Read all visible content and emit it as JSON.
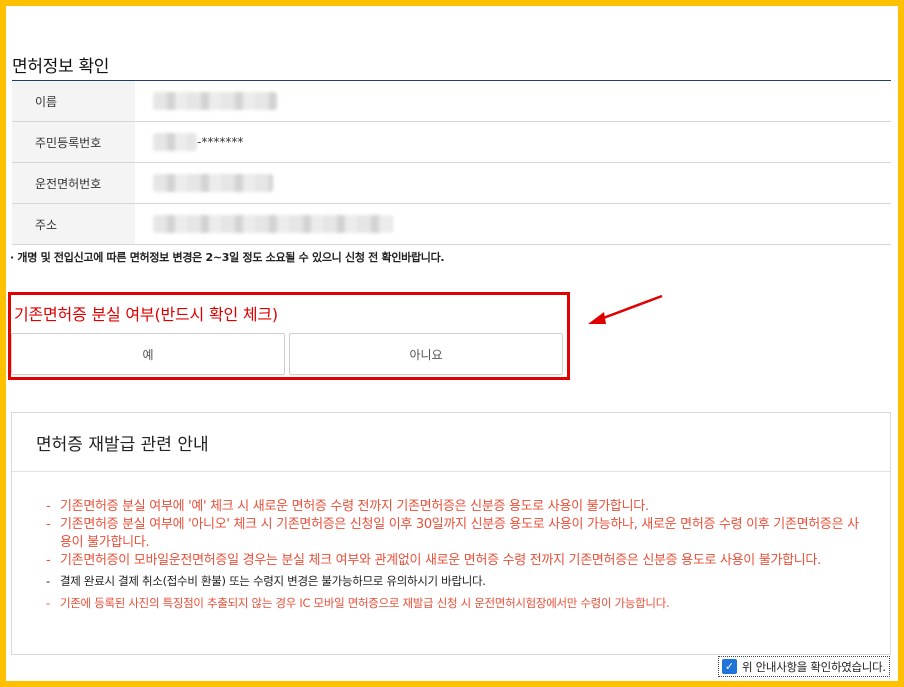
{
  "section": {
    "title": "면허정보 확인"
  },
  "info_rows": [
    {
      "label": "이름",
      "value": "",
      "masked": true
    },
    {
      "label": "주민등록번호",
      "value": "-*******",
      "masked": true
    },
    {
      "label": "운전면허번호",
      "value": "",
      "masked": true
    },
    {
      "label": "주소",
      "value": "",
      "masked": true
    }
  ],
  "notice": "· 개명 및 전입신고에 따른 면허정보 변경은 2~3일 정도 소요될 수 있으니 신청 전 확인바랍니다.",
  "lost_card": {
    "title": "기존면허증 분실 여부(반드시 확인 체크)",
    "yes_label": "예",
    "no_label": "아니요"
  },
  "guide": {
    "title": "면허증 재발급 관련 안내",
    "items": [
      "기존면허증 분실 여부에 '예' 체크 시 새로운 면허증 수령 전까지 기존면허증은 신분증 용도로 사용이 불가합니다.",
      "기존면허증 분실 여부에 '아니오' 체크 시 기존면허증은 신청일 이후 30일까지 신분증 용도로 사용이 가능하나, 새로운 면허증 수령 이후 기존면허증은 사용이 불가합니다.",
      "기존면허증이 모바일운전면허증일 경우는 분실 체크 여부와 관계없이 새로운 면허증 수령 전까지 기존면허증은 신분증 용도로 사용이 불가합니다.",
      "결제 완료시 결제 취소(접수비 환불) 또는 수령지 변경은 불가능하므로 유의하시기 바랍니다.",
      "기존에 등록된 사진의 특징점이 추출되지 않는 경우 IC 모바일 면허증으로 재발급 신청 시 운전면허시험장에서만 수령이 가능합니다."
    ]
  },
  "confirm": {
    "label": "위 안내사항을 확인하였습니다.",
    "checked": true
  },
  "colors": {
    "border": "#ffc000",
    "accent_red": "#e00000",
    "guide_red": "#e8503a",
    "checkbox": "#1e74d8",
    "table_top": "#1f3f6b"
  },
  "icons": {
    "arrow": "red-arrow-icon",
    "check": "check-icon"
  }
}
